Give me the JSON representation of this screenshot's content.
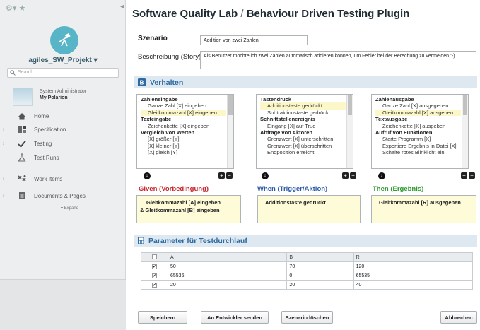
{
  "sidebar": {
    "project_name": "agiles_SW_Projekt",
    "search_placeholder": "Search",
    "user_role": "System Administrator",
    "user_name": "My Polarion",
    "nav": [
      {
        "label": "Home",
        "icon": "home-icon"
      },
      {
        "label": "Specification",
        "icon": "specification-icon"
      },
      {
        "label": "Testing",
        "icon": "checkmark-icon"
      },
      {
        "label": "Test Runs",
        "icon": "flask-icon"
      },
      {
        "label": "Work Items",
        "icon": "work-items-icon"
      },
      {
        "label": "Documents & Pages",
        "icon": "documents-icon"
      }
    ],
    "expand_label": "▾ Expand"
  },
  "header": {
    "title_left": "Software Quality Lab",
    "title_sep": "/",
    "title_right": "Behaviour Driven Testing Plugin"
  },
  "scenario": {
    "label": "Szenario",
    "value": "Addition von zwei Zahlen",
    "desc_label": "Beschreibung (Story)",
    "desc_value": "Als Benutzer möchte ich zwei Zahlen automatisch addieren können, um Fehler bei der Berechung zu vermeiden :-)"
  },
  "behaviour": {
    "title": "Verhalten",
    "given_list": [
      {
        "t": "h",
        "text": "Zahleneingabe"
      },
      {
        "t": "i",
        "text": "Ganze Zahl [X] eingeben"
      },
      {
        "t": "i",
        "text": "Gleitkommazahl [X] eingeben",
        "hl": true
      },
      {
        "t": "h",
        "text": "Texteingabe"
      },
      {
        "t": "i",
        "text": "Zeichenkette [X] eingeben"
      },
      {
        "t": "h",
        "text": "Vergleich von Werten"
      },
      {
        "t": "i",
        "text": "[X] größer [Y]"
      },
      {
        "t": "i",
        "text": "[X] kleiner [Y]"
      },
      {
        "t": "i",
        "text": "[X] gleich [Y]"
      }
    ],
    "when_list": [
      {
        "t": "h",
        "text": "Tastendruck"
      },
      {
        "t": "i",
        "text": "Additionstaste gedrückt",
        "hl": true
      },
      {
        "t": "i",
        "text": "Subtraktionstaste gedrückt"
      },
      {
        "t": "h",
        "text": "Schnittstellenereignis"
      },
      {
        "t": "i",
        "text": "Eingang [X] auf True"
      },
      {
        "t": "h",
        "text": "Abfrage von Aktoren"
      },
      {
        "t": "i",
        "text": "Grenzwert [X] unterschritten"
      },
      {
        "t": "i",
        "text": "Grenzwert [X] überschritten"
      },
      {
        "t": "i",
        "text": "Endposition erreicht"
      }
    ],
    "then_list": [
      {
        "t": "h",
        "text": "Zahlenausgabe"
      },
      {
        "t": "i",
        "text": "Ganze Zahl [X] ausgegeben"
      },
      {
        "t": "i",
        "text": "Gleitkommazahl [X] ausgeben",
        "hl": true
      },
      {
        "t": "h",
        "text": "Textausgabe"
      },
      {
        "t": "i",
        "text": "Zeichenkette [X] ausgeben"
      },
      {
        "t": "h",
        "text": "Aufruf von Funktionen"
      },
      {
        "t": "i",
        "text": "Starte Programm [X]"
      },
      {
        "t": "i",
        "text": "Exportiere Ergebnis in Datei [X]"
      },
      {
        "t": "i",
        "text": "Schalte rotes Blinklicht ein"
      }
    ],
    "given_title": "Given (Vorbedingung)",
    "when_title": "When (Trigger/Aktion)",
    "then_title": "Then (Ergebnis)",
    "given_drop_1": "Gleitkommazahl [A] eingeben",
    "given_drop_2": "Gleitkommazahl [B] eingeben",
    "given_amp": "&",
    "when_drop": "Additionstaste gedrückt",
    "then_drop": "Gleitkommazahl [R] ausgegeben",
    "colors": {
      "given": "#c8232b",
      "when": "#2a5aa8",
      "then": "#2e9a2e"
    }
  },
  "params": {
    "title": "Parameter für Testdurchlauf",
    "headers": [
      "A",
      "B",
      "R"
    ],
    "rows": [
      [
        "50",
        "70",
        "120"
      ],
      [
        "65536",
        "0",
        "65535"
      ],
      [
        "20",
        "20",
        "40"
      ]
    ]
  },
  "buttons": {
    "save": "Speichern",
    "send": "An Entwickler senden",
    "delete": "Szenario löschen",
    "cancel": "Abbrechen"
  }
}
